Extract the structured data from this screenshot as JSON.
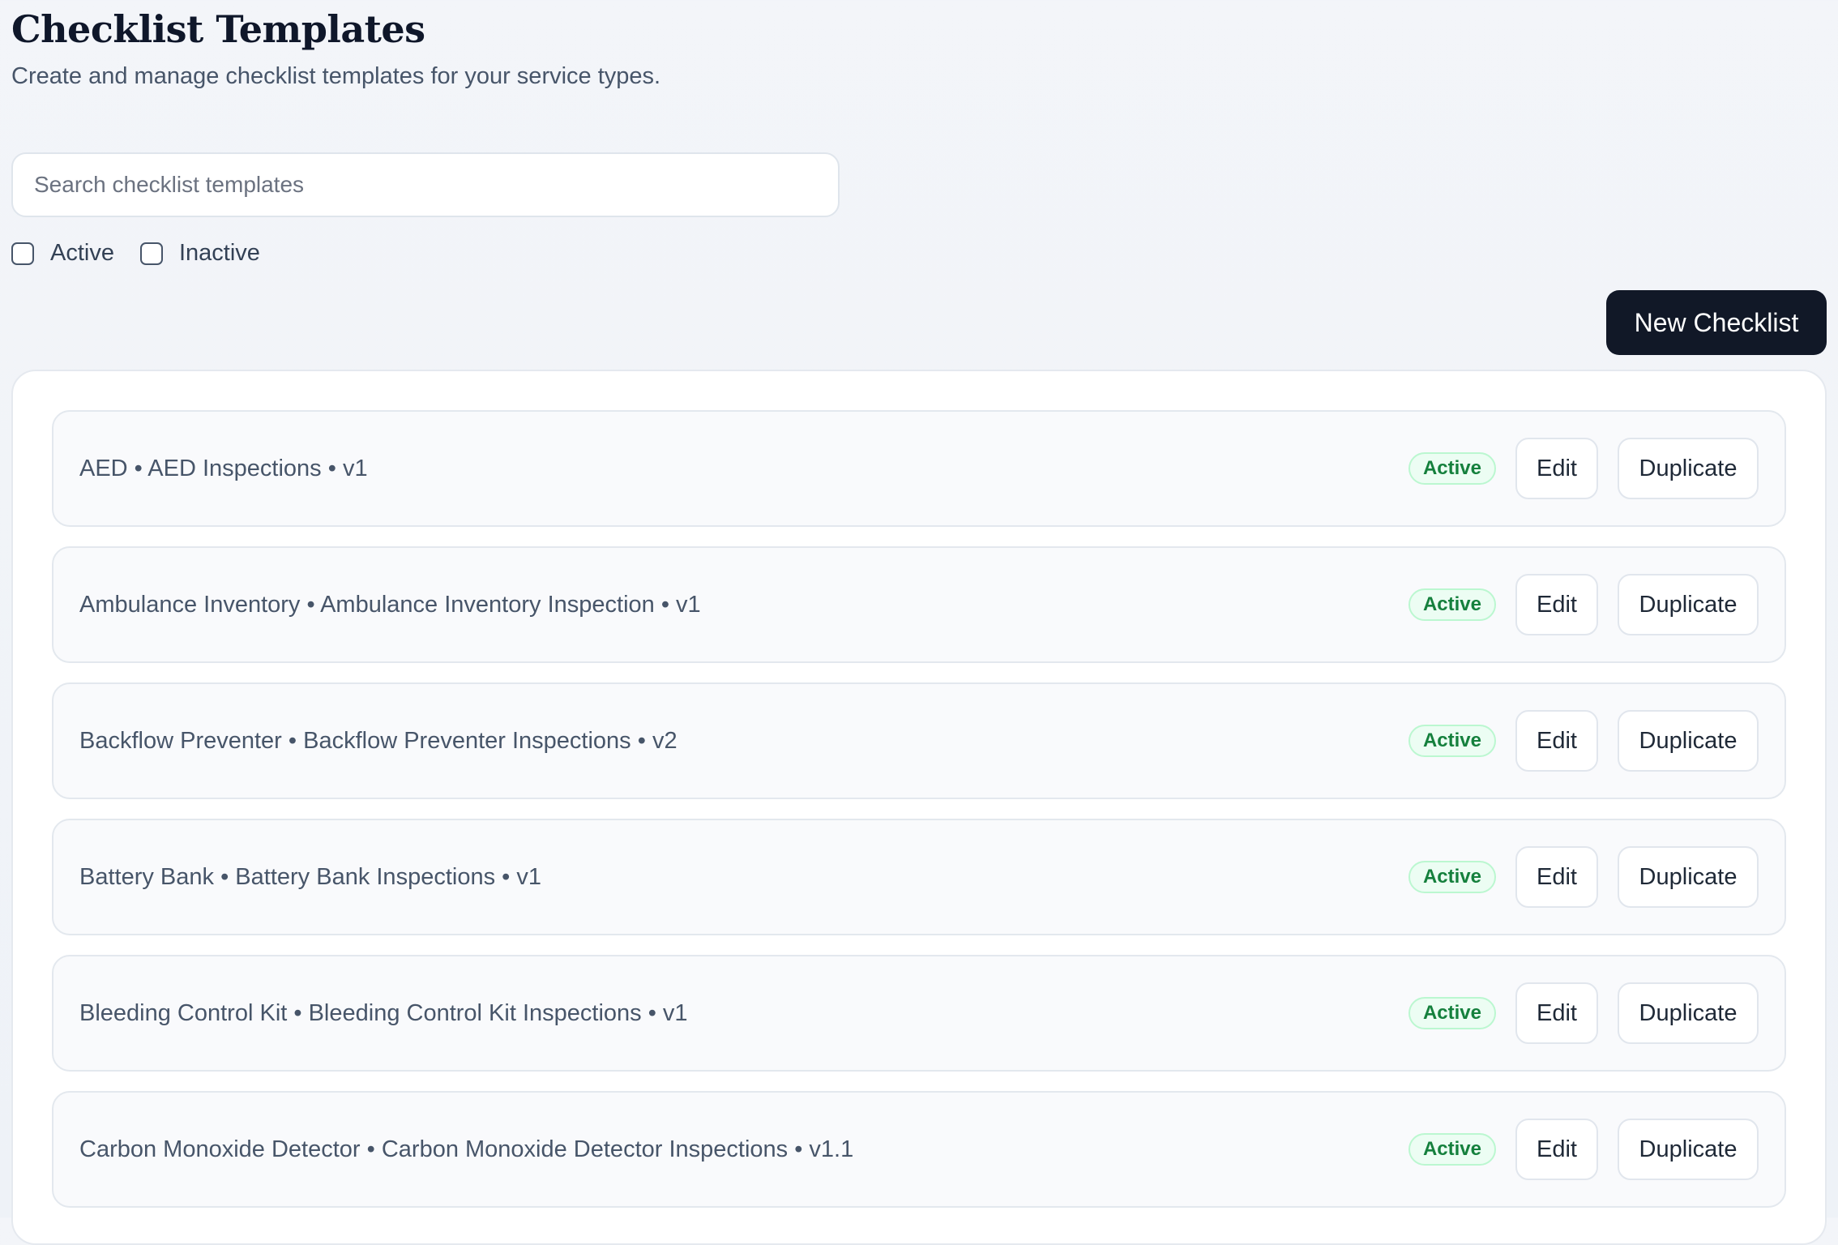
{
  "header": {
    "title": "Checklist Templates",
    "subtitle": "Create and manage checklist templates for your service types."
  },
  "search": {
    "placeholder": "Search checklist templates",
    "value": ""
  },
  "filters": {
    "active_label": "Active",
    "inactive_label": "Inactive"
  },
  "toolbar": {
    "new_label": "New Checklist"
  },
  "row_actions": {
    "edit_label": "Edit",
    "duplicate_label": "Duplicate"
  },
  "templates": [
    {
      "text": "AED • AED Inspections • v1",
      "status": "Active"
    },
    {
      "text": "Ambulance Inventory • Ambulance Inventory Inspection • v1",
      "status": "Active"
    },
    {
      "text": "Backflow Preventer • Backflow Preventer Inspections • v2",
      "status": "Active"
    },
    {
      "text": "Battery Bank • Battery Bank Inspections • v1",
      "status": "Active"
    },
    {
      "text": "Bleeding Control Kit • Bleeding Control Kit Inspections • v1",
      "status": "Active"
    },
    {
      "text": "Carbon Monoxide Detector • Carbon Monoxide Detector Inspections • v1.1",
      "status": "Active"
    }
  ],
  "colors": {
    "primary_button": "#111827",
    "active_badge_text": "#15803d",
    "active_badge_bg": "#ecfdf3"
  }
}
